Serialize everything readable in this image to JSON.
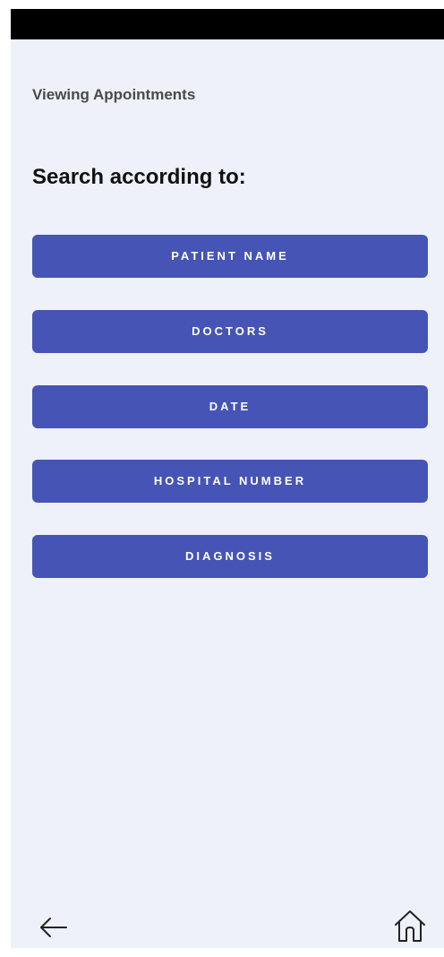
{
  "header": {
    "screen_label": "Viewing Appointments"
  },
  "main": {
    "heading": "Search according to:",
    "options": [
      {
        "label": "PATIENT NAME"
      },
      {
        "label": "DOCTORS"
      },
      {
        "label": "DATE"
      },
      {
        "label": "HOSPITAL NUMBER"
      },
      {
        "label": "DIAGNOSIS"
      }
    ]
  },
  "bottom_nav": {
    "back_icon": "arrow-left-icon",
    "home_icon": "home-icon"
  },
  "colors": {
    "background": "#eef1fa",
    "button": "#4554b5",
    "button_text": "#ffffff",
    "status_bar": "#000000"
  }
}
